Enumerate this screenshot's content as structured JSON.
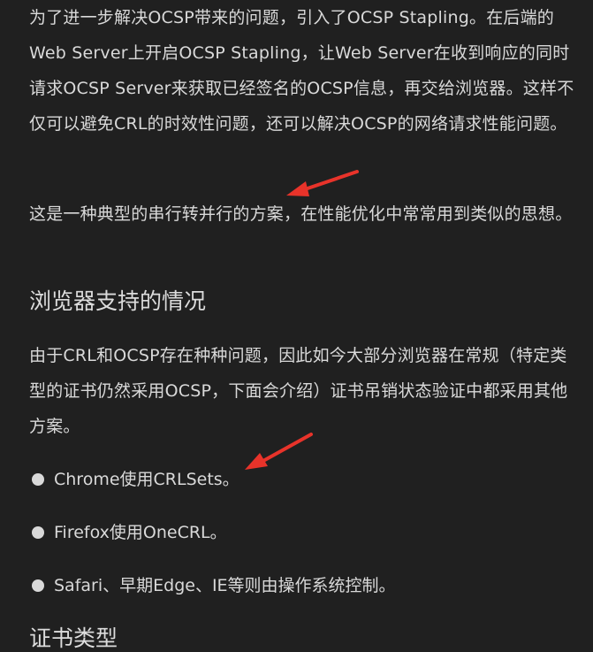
{
  "article": {
    "paragraph_ocsp_stapling": "为了进一步解决OCSP带来的问题，引入了OCSP Stapling。在后端的Web Server上开启OCSP Stapling，让Web Server在收到响应的同时请求OCSP Server来获取已经签名的OCSP信息，再交给浏览器。这样不仅可以避免CRL的时效性问题，还可以解决OCSP的网络请求性能问题。",
    "paragraph_serial_to_parallel": "这是一种典型的串行转并行的方案，在性能优化中常常用到类似的思想。",
    "heading_browser_support": "浏览器支持的情况",
    "paragraph_browser_intro": "由于CRL和OCSP存在种种问题，因此如今大部分浏览器在常规（特定类型的证书仍然采用OCSP，下面会介绍）证书吊销状态验证中都采用其他方案。",
    "browser_list": [
      {
        "text": "Chrome使用CRLSets。"
      },
      {
        "text": "Firefox使用OneCRL。"
      },
      {
        "text": "Safari、早期Edge、IE等则由操作系统控制。"
      }
    ],
    "heading_cert_types": "证书类型"
  },
  "annotations": {
    "arrow_color": "#e8332a",
    "arrow_icon": "red-arrow-icon"
  }
}
